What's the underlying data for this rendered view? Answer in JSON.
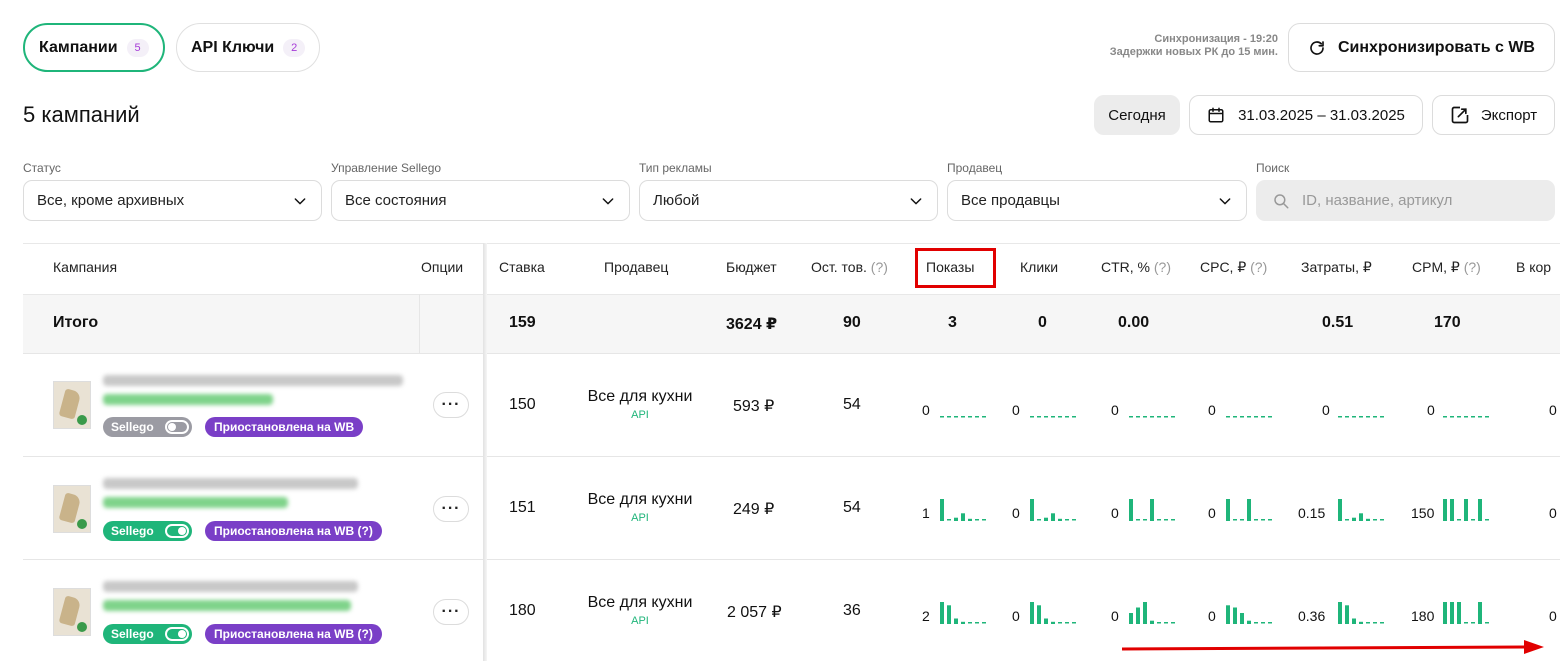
{
  "tabs": [
    {
      "label": "Кампании",
      "count": "5"
    },
    {
      "label": "API Ключи",
      "count": "2"
    }
  ],
  "sync": {
    "line1": "Синхронизация - 19:20",
    "line2": "Задержки новых РК до 15 мин.",
    "button_label": "Синхронизировать с WB"
  },
  "page_title": "5 кампаний",
  "date": {
    "today_label": "Сегодня",
    "range": "31.03.2025 – 31.03.2025",
    "export_label": "Экспорт"
  },
  "filters": {
    "status": {
      "label": "Статус",
      "value": "Все, кроме архивных"
    },
    "management": {
      "label": "Управление Sellego",
      "value": "Все состояния"
    },
    "ad_type": {
      "label": "Тип рекламы",
      "value": "Любой"
    },
    "seller": {
      "label": "Продавец",
      "value": "Все продавцы"
    },
    "search": {
      "label": "Поиск",
      "placeholder": "ID, название, артикул"
    }
  },
  "columns": {
    "campaign": "Кампания",
    "options": "Опции",
    "bid": "Ставка",
    "seller": "Продавец",
    "budget": "Бюджет",
    "stock": "Ост. тов.",
    "stock_q": "(?)",
    "impressions": "Показы",
    "clicks": "Клики",
    "ctr": "CTR, %",
    "ctr_q": "(?)",
    "cpc": "CPC, ₽",
    "cpc_q": "(?)",
    "spend": "Затраты, ₽",
    "cpm": "CPM, ₽",
    "cpm_q": "(?)",
    "cart": "В кор"
  },
  "totals": {
    "label": "Итого",
    "bid": "159",
    "budget": "3624 ₽",
    "stock": "90",
    "impressions": "3",
    "clicks": "0",
    "ctr": "0.00",
    "spend": "0.51",
    "cpm": "170"
  },
  "rows": [
    {
      "sellego": "Sellego",
      "sellego_on": false,
      "status": "Приостановлена на WB",
      "bid": "150",
      "seller": "Все для кухни",
      "seller_src": "API",
      "budget": "593 ₽",
      "stock": "54",
      "impressions": "0",
      "clicks": "0",
      "ctr": "0",
      "cpc": "0",
      "spend": "0",
      "cpm": "0",
      "cart": "0",
      "spark": {
        "impressions": [
          0,
          0,
          0,
          0,
          0,
          0,
          0
        ],
        "clicks": [
          0,
          0,
          0,
          0,
          0,
          0,
          0
        ],
        "ctr": [
          0,
          0,
          0,
          0,
          0,
          0,
          0
        ],
        "cpc": [
          0,
          0,
          0,
          0,
          0,
          0,
          0
        ],
        "spend": [
          0,
          0,
          0,
          0,
          0,
          0,
          0
        ],
        "cpm": [
          0,
          0,
          0,
          0,
          0,
          0,
          0
        ]
      }
    },
    {
      "sellego": "Sellego",
      "sellego_on": true,
      "status": "Приостановлена на WB (?)",
      "bid": "151",
      "seller": "Все для кухни",
      "seller_src": "API",
      "budget": "249 ₽",
      "stock": "54",
      "impressions": "1",
      "clicks": "0",
      "ctr": "0",
      "cpc": "0",
      "spend": "0.15",
      "cpm": "150",
      "cart": "0",
      "spark": {
        "impressions": [
          1,
          0,
          0.15,
          0.35,
          0.1,
          0,
          0
        ],
        "clicks": [
          1,
          0,
          0.15,
          0.35,
          0.1,
          0,
          0
        ],
        "ctr": [
          1,
          0,
          0,
          1,
          0,
          0,
          0
        ],
        "cpc": [
          1,
          0,
          0,
          1,
          0,
          0,
          0
        ],
        "spend": [
          1,
          0,
          0.15,
          0.35,
          0.1,
          0,
          0
        ],
        "cpm": [
          1,
          1,
          0,
          1,
          0,
          1,
          0
        ]
      }
    },
    {
      "sellego": "Sellego",
      "sellego_on": true,
      "status": "Приостановлена на WB (?)",
      "bid": "180",
      "seller": "Все для кухни",
      "seller_src": "API",
      "budget": "2 057 ₽",
      "stock": "36",
      "impressions": "2",
      "clicks": "0",
      "ctr": "0",
      "cpc": "0",
      "spend": "0.36",
      "cpm": "180",
      "cart": "0",
      "spark": {
        "impressions": [
          1,
          0.85,
          0.25,
          0.1,
          0,
          0,
          0
        ],
        "clicks": [
          1,
          0.85,
          0.25,
          0.1,
          0,
          0,
          0
        ],
        "ctr": [
          0.5,
          0.75,
          1,
          0.15,
          0,
          0,
          0
        ],
        "cpc": [
          0.85,
          0.75,
          0.5,
          0.15,
          0,
          0,
          0
        ],
        "spend": [
          1,
          0.85,
          0.25,
          0.1,
          0,
          0,
          0
        ],
        "cpm": [
          1,
          1,
          1,
          0,
          0,
          1,
          0
        ]
      }
    }
  ],
  "colors": {
    "accent": "#1fb57a",
    "status_purple": "#7a3fc7",
    "highlight_red": "#e10000"
  }
}
